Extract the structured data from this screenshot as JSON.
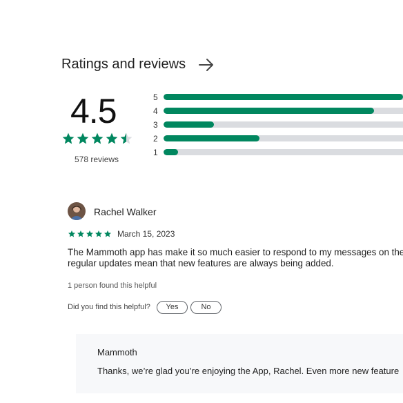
{
  "section": {
    "title": "Ratings and reviews",
    "arrow_icon": "arrow-right-icon"
  },
  "summary": {
    "score": "4.5",
    "star_rating": 4.5,
    "review_count": "578 reviews",
    "accent_color": "#01875f",
    "track_color": "#dadce0"
  },
  "histogram": [
    {
      "label": "5",
      "fraction": 1.0
    },
    {
      "label": "4",
      "fraction": 0.88
    },
    {
      "label": "3",
      "fraction": 0.21
    },
    {
      "label": "2",
      "fraction": 0.4
    },
    {
      "label": "1",
      "fraction": 0.06
    }
  ],
  "review": {
    "reviewer": "Rachel Walker",
    "stars": 5,
    "date": "March 15, 2023",
    "text_line1": "The Mammoth app has make it so much easier to respond to my messages on the",
    "text_line2": "regular updates mean that new features are always being added.",
    "helpful_count": "1 person found this helpful",
    "helpful_question": "Did you find this helpful?",
    "yes_label": "Yes",
    "no_label": "No"
  },
  "reply": {
    "name": "Mammoth",
    "text": "Thanks, we’re glad you’re enjoying the App, Rachel. Even more new feature"
  }
}
